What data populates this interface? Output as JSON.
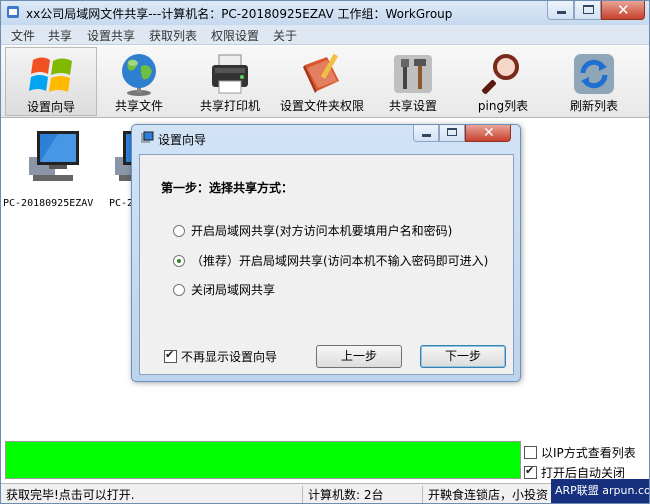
{
  "window": {
    "title": "xx公司局域网文件共享---计算机名：PC-20180925EZAV  工作组：WorkGroup"
  },
  "menu": [
    "文件",
    "共享",
    "设置共享",
    "获取列表",
    "权限设置",
    "关于"
  ],
  "toolbar": [
    {
      "label": "设置向导",
      "icon": "windows-logo-icon",
      "active": true
    },
    {
      "label": "共享文件",
      "icon": "globe-icon",
      "active": false
    },
    {
      "label": "共享打印机",
      "icon": "printer-icon",
      "active": false
    },
    {
      "label": "设置文件夹权限",
      "icon": "book-pencil-icon",
      "active": false
    },
    {
      "label": "共享设置",
      "icon": "tools-icon",
      "active": false
    },
    {
      "label": "ping列表",
      "icon": "magnifier-icon",
      "active": false
    },
    {
      "label": "刷新列表",
      "icon": "refresh-icon",
      "active": false
    }
  ],
  "computers": [
    {
      "name": "PC-20180925EZAV"
    },
    {
      "name": "PC-2"
    }
  ],
  "progress": {
    "fraction": 1.0,
    "color": "#00ff00"
  },
  "options": [
    {
      "label": "以IP方式查看列表",
      "checked": false
    },
    {
      "label": "打开后自动关闭",
      "checked": true
    }
  ],
  "status": {
    "message": "获取完毕!点击可以打开.",
    "count": "计算机数: 2台",
    "info": "开鞅食连锁店，小投资"
  },
  "watermark": "ARP联盟 arpun.com",
  "dialog": {
    "title": "设置向导",
    "step": "第一步：选择共享方式：",
    "options": [
      {
        "label": "开启局域网共享(对方访问本机要填用户名和密码)",
        "selected": false
      },
      {
        "label": "（推荐）开启局域网共享(访问本机不输入密码即可进入)",
        "selected": true
      },
      {
        "label": "关闭局域网共享",
        "selected": false
      }
    ],
    "dont_show": {
      "label": "不再显示设置向导",
      "checked": true
    },
    "prev_label": "上一步",
    "next_label": "下一步"
  }
}
